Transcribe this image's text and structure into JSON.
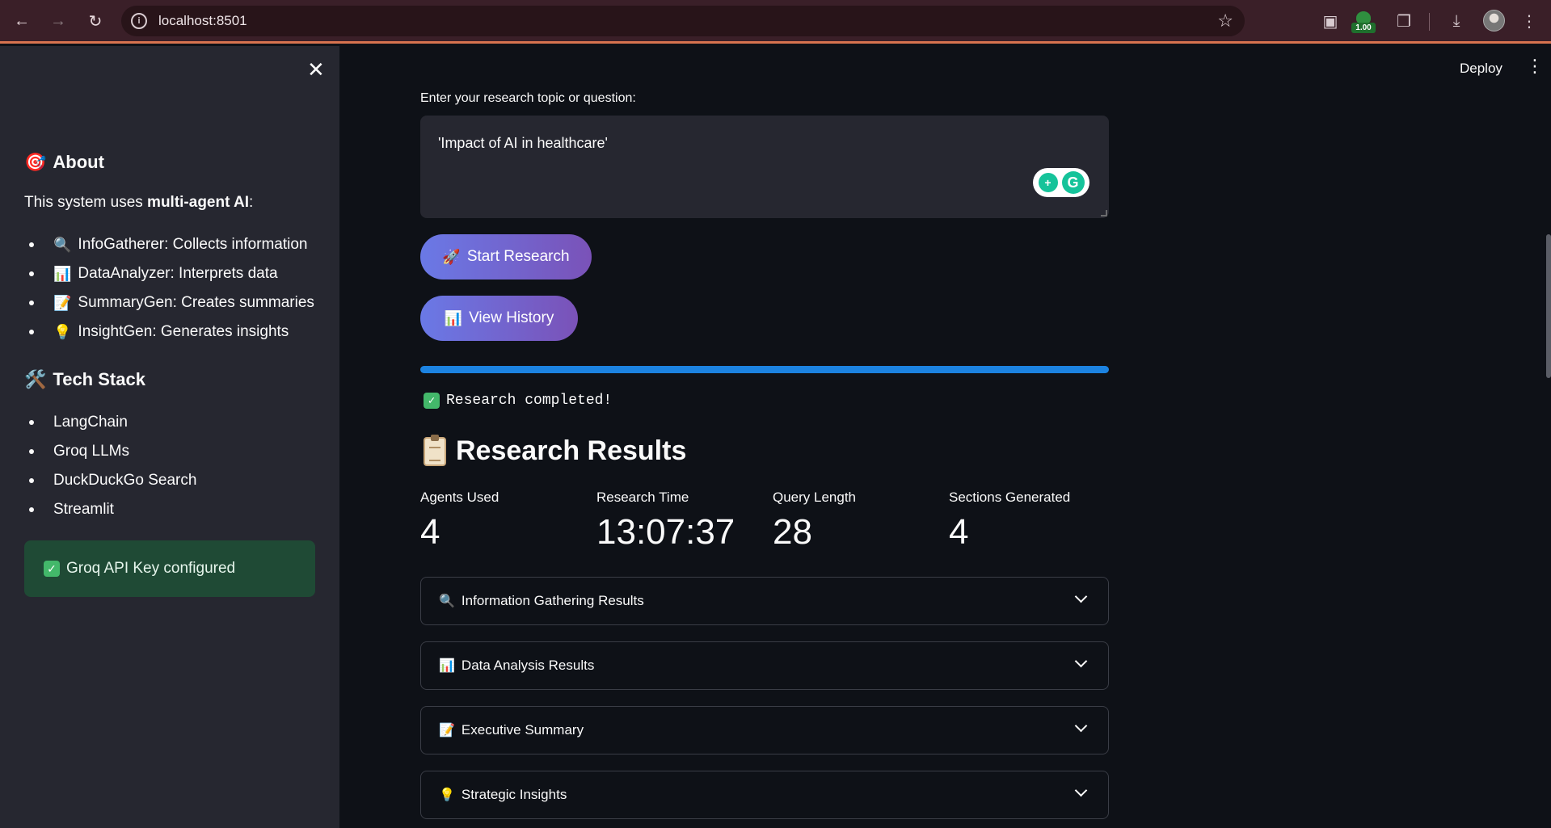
{
  "browser": {
    "url": "localhost:8501",
    "extension_badge": "1.00"
  },
  "sidebar": {
    "about_heading": "About",
    "about_emoji": "🎯",
    "intro_prefix": "This system uses ",
    "intro_bold": "multi-agent AI",
    "intro_suffix": ":",
    "agents": [
      {
        "emoji": "🔍",
        "label": "InfoGatherer: Collects information"
      },
      {
        "emoji": "📊",
        "label": "DataAnalyzer: Interprets data"
      },
      {
        "emoji": "📝",
        "label": "SummaryGen: Creates summaries"
      },
      {
        "emoji": "💡",
        "label": "InsightGen: Generates insights"
      }
    ],
    "tech_heading": "Tech Stack",
    "tech_emoji": "🛠️",
    "tech": [
      "LangChain",
      "Groq LLMs",
      "DuckDuckGo Search",
      "Streamlit"
    ],
    "success_text": "Groq API Key configured"
  },
  "header": {
    "deploy_label": "Deploy"
  },
  "main": {
    "input_label": "Enter your research topic or question:",
    "input_value": "'Impact of AI in healthcare'",
    "start_button": {
      "emoji": "🚀",
      "label": "Start Research"
    },
    "history_button": {
      "emoji": "📊",
      "label": "View History"
    },
    "progress": 1.0,
    "status_text": "Research completed!",
    "results_heading": "Research Results",
    "metrics": [
      {
        "label": "Agents Used",
        "value": "4"
      },
      {
        "label": "Research Time",
        "value": "13:07:37"
      },
      {
        "label": "Query Length",
        "value": "28"
      },
      {
        "label": "Sections Generated",
        "value": "4"
      }
    ],
    "expanders": [
      {
        "emoji": "🔍",
        "label": "Information Gathering Results"
      },
      {
        "emoji": "📊",
        "label": "Data Analysis Results"
      },
      {
        "emoji": "📝",
        "label": "Executive Summary"
      },
      {
        "emoji": "💡",
        "label": "Strategic Insights"
      }
    ]
  },
  "colors": {
    "sidebar_bg": "#262730",
    "main_bg": "#0e1117",
    "progress": "#1c83e1",
    "button_gradient_start": "#6a79e6",
    "button_gradient_end": "#7a52b8",
    "success_bg": "#1f4a35"
  }
}
